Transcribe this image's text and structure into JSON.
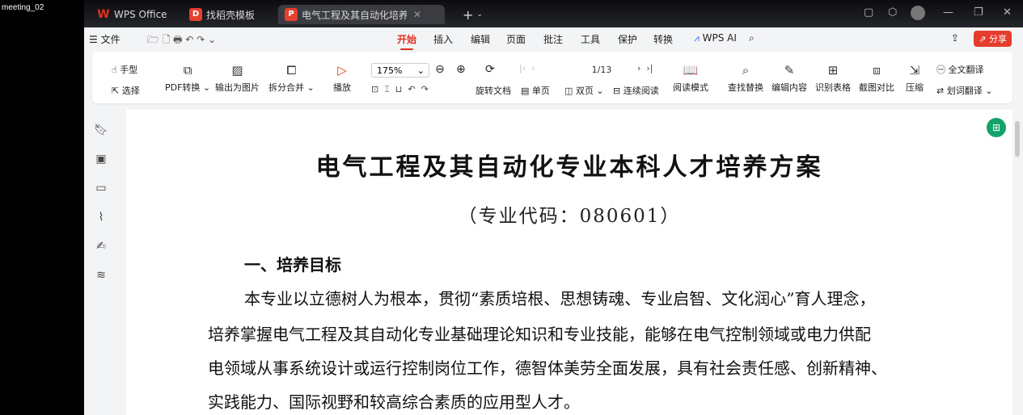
{
  "meeting_label": "meeting_02",
  "titlebar": {
    "tabs": [
      {
        "label": "WPS Office"
      },
      {
        "label": "找稻壳模板"
      },
      {
        "label": "电气工程及其自动化培养方案"
      }
    ],
    "new_tab": "+"
  },
  "menu": {
    "file": "文件",
    "tabs": [
      "开始",
      "插入",
      "编辑",
      "页面",
      "批注",
      "工具",
      "保护",
      "转换"
    ],
    "wps_ai": "WPS AI",
    "share": "分享"
  },
  "ribbon": {
    "hand": "手型",
    "select": "选择",
    "pdf_convert": "PDF转换",
    "export_image": "输出为图片",
    "split_merge": "拆分合并",
    "play": "播放",
    "zoom": "175%",
    "rotate": "旋转文档",
    "page": "1/13",
    "single": "单页",
    "double": "双页",
    "continuous": "连续阅读",
    "read_mode": "阅读模式",
    "find_replace": "查找替换",
    "edit_content": "编辑内容",
    "recognize_table": "识别表格",
    "screenshot_compare": "截图对比",
    "compress": "压缩",
    "full_translate": "全文翻译",
    "word_translate": "划词翻译"
  },
  "document": {
    "title": "电气工程及其自动化专业本科人才培养方案",
    "code": "（专业代码：080601）",
    "section1": "一、培养目标",
    "lines": [
      "本专业以立德树人为根本，贯彻“素质培根、思想铸魂、专业启智、文化润心”育人理念，",
      "培养掌握电气工程及其自动化专业基础理论知识和专业技能，能够在电气控制领域或电力供配",
      "电领域从事系统设计或运行控制岗位工作，德智体美劳全面发展，具有社会责任感、创新精神、",
      "实践能力、国际视野和较高综合素质的应用型人才。"
    ]
  },
  "colors": {
    "accent": "#e0301e",
    "share_bg": "#e63c2d",
    "green": "#13a36a"
  }
}
